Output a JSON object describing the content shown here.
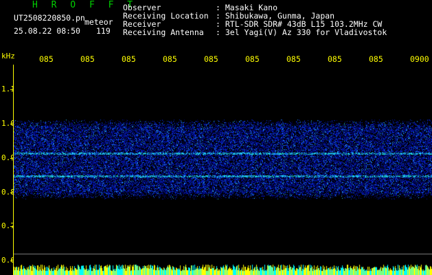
{
  "header": {
    "brand": "H R O F F T",
    "filename": "UT2508220850.pn",
    "meteor_label": "meteor",
    "timestamp": "25.08.22 08:50",
    "count": "119"
  },
  "meta": [
    {
      "key": "Observer",
      "value": ": Masaki Kano"
    },
    {
      "key": "Receiving Location",
      "value": ": Shibukawa, Gunma, Japan"
    },
    {
      "key": "Receiver",
      "value": ": RTL-SDR SDR# 43dB L15 103.2MHz CW"
    },
    {
      "key": "Receiving Antenna",
      "value": ": 3el Yagi(V) Az 330 for Vladivostok"
    }
  ],
  "axes": {
    "y_unit": "kHz",
    "y_labels": [
      "1.1",
      "1.0",
      "0.9",
      "0.8",
      "0.7",
      "0.6"
    ],
    "x_labels": [
      "085",
      "085",
      "085",
      "085",
      "085",
      "085",
      "085",
      "085",
      "085",
      "0900"
    ]
  },
  "colors": {
    "axis": "#ffff00",
    "signal": "#2a4cff",
    "band": "#40ffe0"
  }
}
